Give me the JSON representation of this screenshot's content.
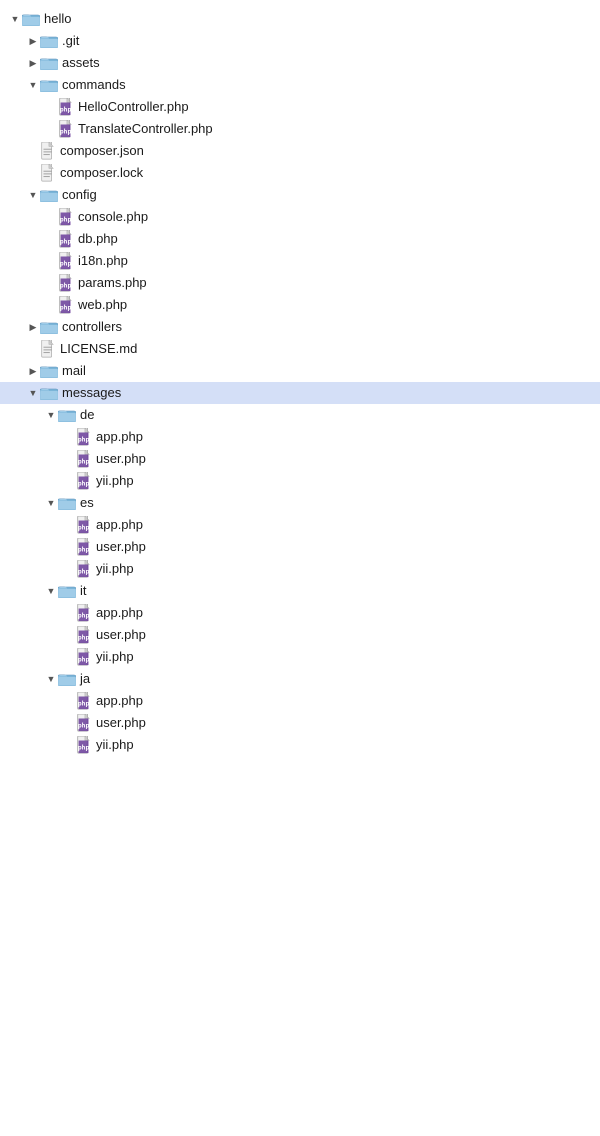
{
  "tree": {
    "items": [
      {
        "id": "hello",
        "label": "hello",
        "type": "folder",
        "state": "open",
        "depth": 0,
        "selected": false
      },
      {
        "id": "git",
        "label": ".git",
        "type": "folder",
        "state": "closed",
        "depth": 1,
        "selected": false
      },
      {
        "id": "assets",
        "label": "assets",
        "type": "folder",
        "state": "closed",
        "depth": 1,
        "selected": false
      },
      {
        "id": "commands",
        "label": "commands",
        "type": "folder",
        "state": "open",
        "depth": 1,
        "selected": false
      },
      {
        "id": "hello-controller",
        "label": "HelloController.php",
        "type": "php",
        "state": "leaf",
        "depth": 2,
        "selected": false
      },
      {
        "id": "translate-controller",
        "label": "TranslateController.php",
        "type": "php",
        "state": "leaf",
        "depth": 2,
        "selected": false
      },
      {
        "id": "composer-json",
        "label": "composer.json",
        "type": "txt",
        "state": "leaf",
        "depth": 1,
        "selected": false
      },
      {
        "id": "composer-lock",
        "label": "composer.lock",
        "type": "txt",
        "state": "leaf",
        "depth": 1,
        "selected": false
      },
      {
        "id": "config",
        "label": "config",
        "type": "folder",
        "state": "open",
        "depth": 1,
        "selected": false
      },
      {
        "id": "console-php",
        "label": "console.php",
        "type": "php",
        "state": "leaf",
        "depth": 2,
        "selected": false
      },
      {
        "id": "db-php",
        "label": "db.php",
        "type": "php",
        "state": "leaf",
        "depth": 2,
        "selected": false
      },
      {
        "id": "i18n-php",
        "label": "i18n.php",
        "type": "php",
        "state": "leaf",
        "depth": 2,
        "selected": false
      },
      {
        "id": "params-php",
        "label": "params.php",
        "type": "php",
        "state": "leaf",
        "depth": 2,
        "selected": false
      },
      {
        "id": "web-php",
        "label": "web.php",
        "type": "php",
        "state": "leaf",
        "depth": 2,
        "selected": false
      },
      {
        "id": "controllers",
        "label": "controllers",
        "type": "folder",
        "state": "closed",
        "depth": 1,
        "selected": false
      },
      {
        "id": "license-md",
        "label": "LICENSE.md",
        "type": "txt",
        "state": "leaf",
        "depth": 1,
        "selected": false
      },
      {
        "id": "mail",
        "label": "mail",
        "type": "folder",
        "state": "closed",
        "depth": 1,
        "selected": false
      },
      {
        "id": "messages",
        "label": "messages",
        "type": "folder",
        "state": "open",
        "depth": 1,
        "selected": true
      },
      {
        "id": "de",
        "label": "de",
        "type": "folder",
        "state": "open",
        "depth": 2,
        "selected": false
      },
      {
        "id": "de-app-php",
        "label": "app.php",
        "type": "php",
        "state": "leaf",
        "depth": 3,
        "selected": false
      },
      {
        "id": "de-user-php",
        "label": "user.php",
        "type": "php",
        "state": "leaf",
        "depth": 3,
        "selected": false
      },
      {
        "id": "de-yii-php",
        "label": "yii.php",
        "type": "php",
        "state": "leaf",
        "depth": 3,
        "selected": false
      },
      {
        "id": "es",
        "label": "es",
        "type": "folder",
        "state": "open",
        "depth": 2,
        "selected": false
      },
      {
        "id": "es-app-php",
        "label": "app.php",
        "type": "php",
        "state": "leaf",
        "depth": 3,
        "selected": false
      },
      {
        "id": "es-user-php",
        "label": "user.php",
        "type": "php",
        "state": "leaf",
        "depth": 3,
        "selected": false
      },
      {
        "id": "es-yii-php",
        "label": "yii.php",
        "type": "php",
        "state": "leaf",
        "depth": 3,
        "selected": false
      },
      {
        "id": "it",
        "label": "it",
        "type": "folder",
        "state": "open",
        "depth": 2,
        "selected": false
      },
      {
        "id": "it-app-php",
        "label": "app.php",
        "type": "php",
        "state": "leaf",
        "depth": 3,
        "selected": false
      },
      {
        "id": "it-user-php",
        "label": "user.php",
        "type": "php",
        "state": "leaf",
        "depth": 3,
        "selected": false
      },
      {
        "id": "it-yii-php",
        "label": "yii.php",
        "type": "php",
        "state": "leaf",
        "depth": 3,
        "selected": false
      },
      {
        "id": "ja",
        "label": "ja",
        "type": "folder",
        "state": "open",
        "depth": 2,
        "selected": false
      },
      {
        "id": "ja-app-php",
        "label": "app.php",
        "type": "php",
        "state": "leaf",
        "depth": 3,
        "selected": false
      },
      {
        "id": "ja-user-php",
        "label": "user.php",
        "type": "php",
        "state": "leaf",
        "depth": 3,
        "selected": false
      },
      {
        "id": "ja-yii-php",
        "label": "yii.php",
        "type": "php",
        "state": "leaf",
        "depth": 3,
        "selected": false
      }
    ]
  }
}
